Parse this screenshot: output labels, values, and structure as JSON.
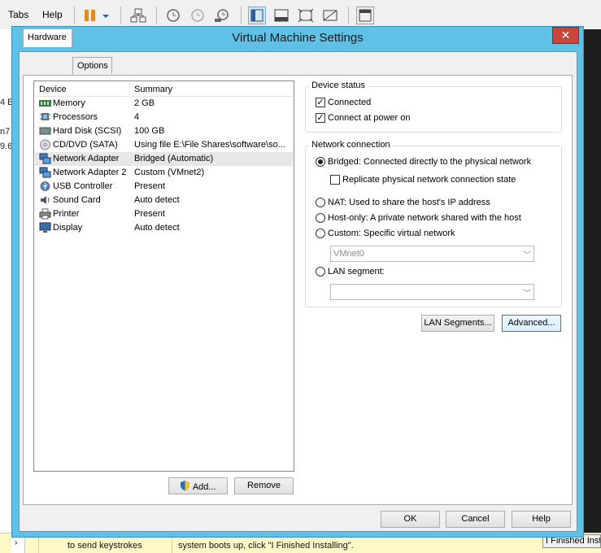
{
  "menu": {
    "tabs": "Tabs",
    "help": "Help"
  },
  "background": {
    "left_texts": [
      "4 B",
      "n7",
      "9.6"
    ],
    "bottom_left": "to send keystrokes",
    "bottom_mid": "system boots up, click \"I Finished Installing\".",
    "bottom_right": "I Finished Inst"
  },
  "dialog": {
    "title": "Virtual Machine Settings",
    "close": "✕",
    "tabs": {
      "hardware": "Hardware",
      "options": "Options"
    },
    "device_list": {
      "col_device": "Device",
      "col_summary": "Summary",
      "rows": [
        {
          "name": "Memory",
          "summary": "2 GB",
          "icon": "memory-icon"
        },
        {
          "name": "Processors",
          "summary": "4",
          "icon": "processor-icon"
        },
        {
          "name": "Hard Disk (SCSI)",
          "summary": "100 GB",
          "icon": "hard-disk-icon"
        },
        {
          "name": "CD/DVD (SATA)",
          "summary": "Using file E:\\File Shares\\software\\so...",
          "icon": "cd-dvd-icon"
        },
        {
          "name": "Network Adapter",
          "summary": "Bridged (Automatic)",
          "icon": "network-adapter-icon"
        },
        {
          "name": "Network Adapter 2",
          "summary": "Custom (VMnet2)",
          "icon": "network-adapter-icon"
        },
        {
          "name": "USB Controller",
          "summary": "Present",
          "icon": "usb-icon"
        },
        {
          "name": "Sound Card",
          "summary": "Auto detect",
          "icon": "sound-icon"
        },
        {
          "name": "Printer",
          "summary": "Present",
          "icon": "printer-icon"
        },
        {
          "name": "Display",
          "summary": "Auto detect",
          "icon": "display-icon"
        }
      ],
      "selected_index": 4
    },
    "add_button": "Add...",
    "remove_button": "Remove",
    "device_status": {
      "title": "Device status",
      "connected": "Connected",
      "connect_power_on": "Connect at power on",
      "connected_checked": true,
      "connect_power_on_checked": true
    },
    "network_connection": {
      "title": "Network connection",
      "bridged": "Bridged: Connected directly to the physical network",
      "replicate": "Replicate physical network connection state",
      "nat": "NAT: Used to share the host's IP address",
      "host_only": "Host-only: A private network shared with the host",
      "custom": "Custom: Specific virtual network",
      "custom_select": "VMnet0",
      "lan_segment": "LAN segment:",
      "lan_segment_select": "",
      "selected": "bridged"
    },
    "lan_segments_button": "LAN Segments...",
    "advanced_button": "Advanced...",
    "ok_button": "OK",
    "cancel_button": "Cancel",
    "help_button": "Help"
  },
  "colors": {
    "title_bar": "#5fc1e6",
    "close": "#c9463d",
    "selection": "#e7e7e7"
  }
}
